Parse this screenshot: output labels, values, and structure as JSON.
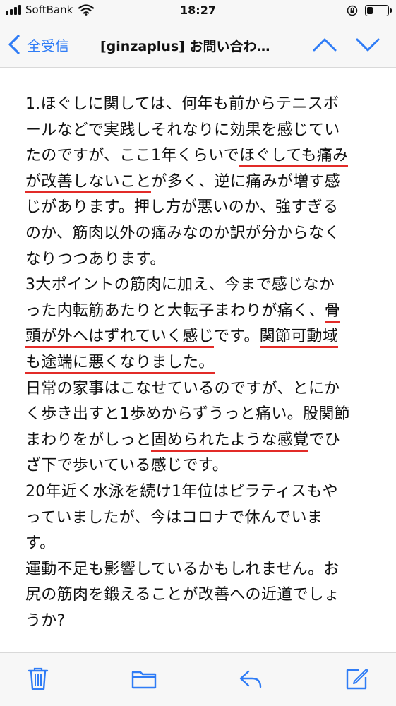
{
  "status_bar": {
    "carrier": "SoftBank",
    "time": "18:27",
    "battery_level": 0.3
  },
  "nav": {
    "back_label": "全受信",
    "title": "[ginzaplus] お問い合わ…",
    "icons": [
      "chevron-left-icon",
      "chevron-up-icon",
      "chevron-down-icon"
    ]
  },
  "body_lines": [
    [
      {
        "t": "1.ほぐしに関しては、何年も前からテニスボ"
      }
    ],
    [
      {
        "t": "ールなどで実践しそれなりに効果を感じてい"
      }
    ],
    [
      {
        "t": "たのですが、ここ1年くらいで"
      },
      {
        "t": "ほぐしても痛み",
        "u": true
      }
    ],
    [
      {
        "t": "が改善しないこと",
        "u": true
      },
      {
        "t": "が多く、逆に痛みが増す感"
      }
    ],
    [
      {
        "t": "じがあります。押し方が悪いのか、強すぎる"
      }
    ],
    [
      {
        "t": "のか、筋肉以外の痛みなのか訳が分からなく"
      }
    ],
    [
      {
        "t": "なりつつあります。"
      }
    ],
    [
      {
        "t": "3大ポイントの筋肉に加え、今まで感じなか"
      }
    ],
    [
      {
        "t": "った内転筋あたりと大転子まわりが痛く、"
      },
      {
        "t": "骨",
        "u": true
      }
    ],
    [
      {
        "t": "頭が外へはずれていく感じ",
        "u": true
      },
      {
        "t": "です。"
      },
      {
        "t": "関節可動域",
        "u": true
      }
    ],
    [
      {
        "t": "も途端に悪くなりました。",
        "u": true
      }
    ],
    [
      {
        "t": "日常の家事はこなせているのですが、とにか"
      }
    ],
    [
      {
        "t": "く歩き出すと1歩めからずうっと痛い。股関節"
      }
    ],
    [
      {
        "t": "まわりをがしっと"
      },
      {
        "t": "固められたような感覚",
        "u": true
      },
      {
        "t": "でひ"
      }
    ],
    [
      {
        "t": "ざ下で歩いている感じです。"
      }
    ],
    [
      {
        "t": "20年近く水泳を続け1年位はピラティスもや"
      }
    ],
    [
      {
        "t": "っていましたが、今はコロナで休んでいま"
      }
    ],
    [
      {
        "t": "す。"
      }
    ],
    [
      {
        "t": "運動不足も影響しているかもしれません。お"
      }
    ],
    [
      {
        "t": "尻の筋肉を鍛えることが改善への近道でしょ"
      }
    ],
    [
      {
        "t": "うか?"
      }
    ]
  ],
  "colors": {
    "accent": "#2f7cf6",
    "underline": "#e22b28",
    "bar_bg": "#f7f7f7"
  },
  "toolbar": {
    "icons": [
      "trash-icon",
      "folder-icon",
      "reply-icon",
      "compose-icon"
    ]
  }
}
